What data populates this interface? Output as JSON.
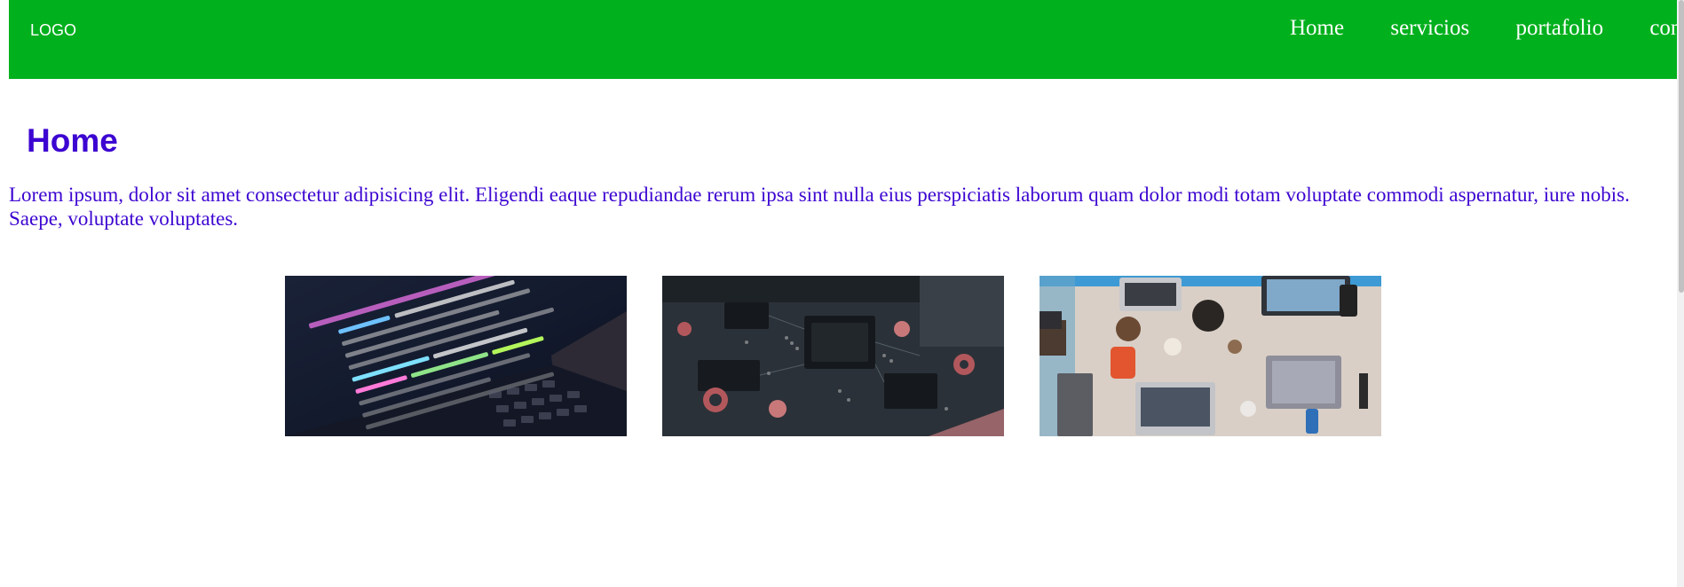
{
  "header": {
    "logo": "LOGO",
    "nav": [
      "Home",
      "servicios",
      "portafolio",
      "con"
    ]
  },
  "main": {
    "heading": "Home",
    "paragraph": "Lorem ipsum, dolor sit amet consectetur adipisicing elit. Eligendi eaque repudiandae rerum ipsa sint nulla eius perspiciatis laborum quam dolor modi totam voluptate commodi aspernatur, iure nobis. Saepe, voluptate voluptates."
  },
  "colors": {
    "navbar": "#00b01d",
    "text_accent": "#3c05d1"
  }
}
